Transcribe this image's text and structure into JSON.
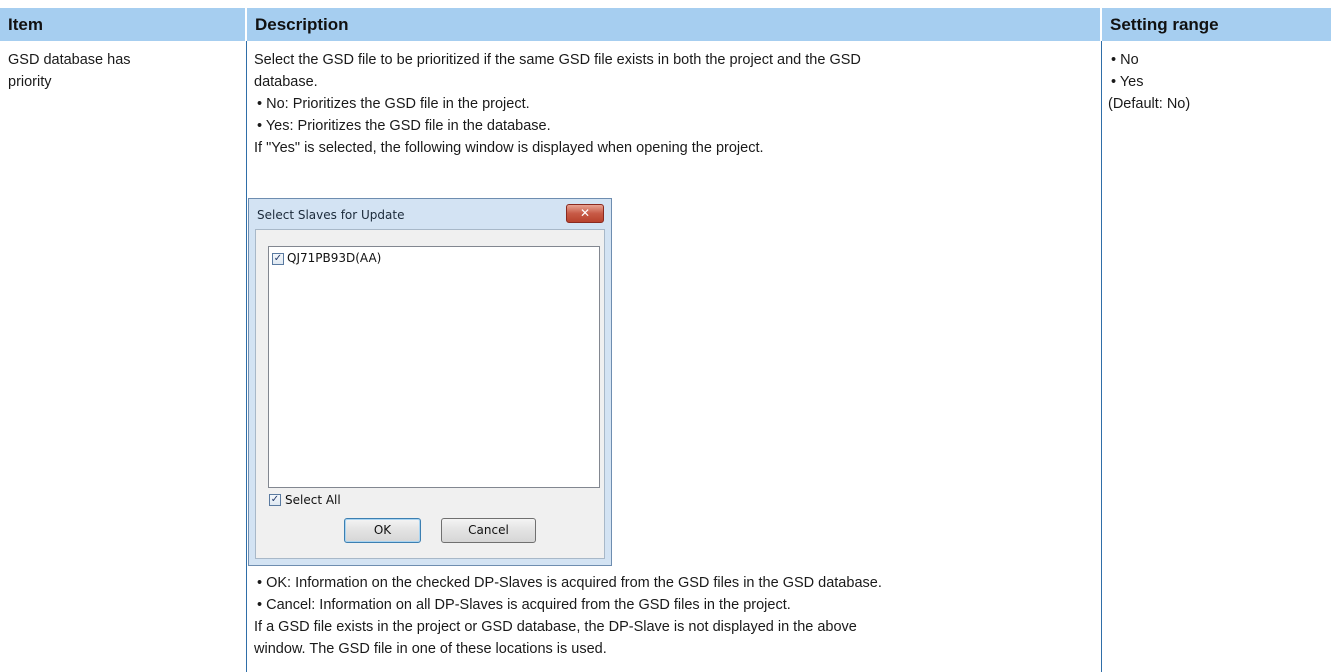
{
  "table": {
    "headers": {
      "item": "Item",
      "description": "Description",
      "setting_range": "Setting range"
    },
    "row": {
      "item_lines": [
        "GSD database has",
        "priority"
      ],
      "description": {
        "intro_lines": [
          "Select the GSD file to be prioritized if the same GSD file exists in both the project and the GSD",
          "database."
        ],
        "bullets1": [
          "• No: Prioritizes the GSD file in the project.",
          "• Yes: Prioritizes the GSD file in the database."
        ],
        "window_note": "If \"Yes\" is selected, the following window is displayed when opening the project.",
        "bullets2": [
          "• OK: Information on the checked DP-Slaves is acquired from the GSD files in the GSD database.",
          "• Cancel: Information on all DP-Slaves is acquired from the GSD files in the project."
        ],
        "outro_lines": [
          "If a GSD file exists in the project or GSD database, the DP-Slave is not displayed in the above",
          "window. The GSD file in one of these locations is used."
        ]
      },
      "setting_range": [
        "• No",
        "• Yes",
        "(Default: No)"
      ]
    }
  },
  "dialog": {
    "title": "Select Slaves for Update",
    "close_glyph": "✕",
    "list_items": [
      {
        "label": "QJ71PB93D(AA)",
        "checked": true
      }
    ],
    "select_all": {
      "label": "Select All",
      "checked": true
    },
    "ok_label": "OK",
    "cancel_label": "Cancel",
    "check_glyph": "✓"
  },
  "colors": {
    "header_bg": "#a6cef0",
    "rule": "#2f6ea8",
    "dialog_frame": "#d3e3f3",
    "close_red": "#c75a46"
  }
}
